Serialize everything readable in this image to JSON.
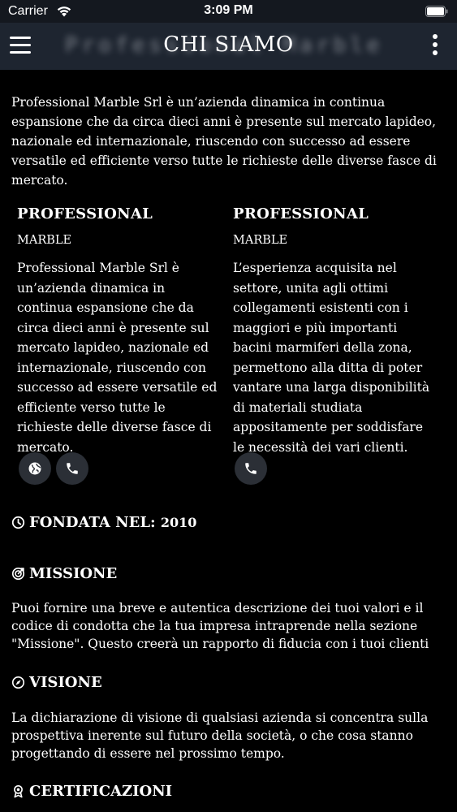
{
  "status": {
    "carrier": "Carrier",
    "time": "3:09 PM"
  },
  "nav": {
    "title": "CHI SIAMO",
    "blurred_brand": "Professional Marble",
    "menu_icon": "hamburger-menu-icon",
    "more_icon": "vertical-dots-icon"
  },
  "intro": "Professional Marble Srl è un’azienda dinamica in continua espansione che da circa dieci anni è presente sul mercato lapideo, nazionale ed internazionale, riuscendo con successo ad essere versatile ed efficiente verso tutte le richieste delle diverse fasce di mercato.",
  "columns": [
    {
      "title": "PROFESSIONAL",
      "subtitle": "MARBLE",
      "text": "Professional Marble Srl è un’azienda dinamica in continua espansione che da circa dieci anni è presente sul mercato lapideo, nazionale ed internazionale, riuscendo con successo ad essere versatile ed efficiente verso tutte le richieste delle diverse fasce di mercato.",
      "actions": [
        "globe-icon",
        "phone-icon"
      ]
    },
    {
      "title": "PROFESSIONAL",
      "subtitle": "MARBLE",
      "text": "L’esperienza acquisita nel settore, unita agli ottimi collegamenti esistenti con i maggiori e più importanti bacini marmiferi della zona, permettono alla ditta di poter vantare una larga disponibilità di materiali studiata appositamente per soddisfare le necessità dei vari clienti.",
      "actions": [
        "phone-icon"
      ]
    }
  ],
  "founded": {
    "label": "FONDATA NEL:",
    "year": "2010"
  },
  "mission": {
    "title": "MISSIONE",
    "text": "Puoi fornire una breve e autentica descrizione dei tuoi valori e il codice di condotta che la tua impresa intraprende nella sezione \"Missione\". Questo creerà un rapporto di fiducia con i tuoi clienti"
  },
  "vision": {
    "title": "VISIONE",
    "text": "La dichiarazione di visione di qualsiasi azienda si concentra sulla prospettiva inerente sul futuro della società, o che cosa stanno progettando di essere nel prossimo tempo."
  },
  "certifications": {
    "title": "CERTIFICAZIONI"
  },
  "colors": {
    "background": "#000000",
    "nav_bar": "#1e2530",
    "status_bar": "#14181f",
    "button_bg": "#2b2f36",
    "text": "#ffffff"
  }
}
